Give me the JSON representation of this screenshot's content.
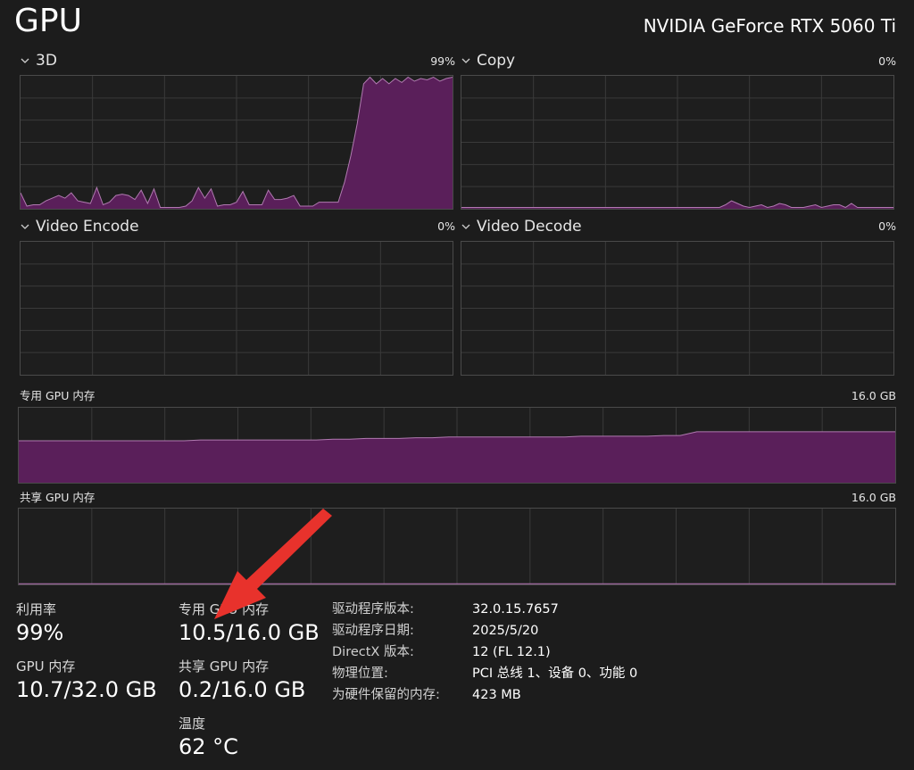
{
  "header": {
    "title": "GPU",
    "model": "NVIDIA GeForce RTX 5060 Ti"
  },
  "engines": [
    {
      "label": "3D",
      "pct": "99%",
      "values": [
        12,
        2,
        3,
        3,
        6,
        8,
        10,
        8,
        12,
        6,
        5,
        4,
        16,
        3,
        5,
        10,
        11,
        10,
        7,
        14,
        4,
        15,
        1,
        1,
        1,
        1,
        2,
        6,
        16,
        8,
        15,
        2,
        3,
        3,
        5,
        13,
        3,
        3,
        3,
        14,
        7,
        7,
        8,
        10,
        2,
        2,
        2,
        5,
        5,
        5,
        5,
        20,
        40,
        64,
        94,
        99,
        94,
        98,
        94,
        98,
        95,
        99,
        96,
        98,
        97,
        99,
        96,
        98,
        99
      ]
    },
    {
      "label": "Copy",
      "pct": "0%",
      "values": [
        1,
        1,
        1,
        1,
        1,
        1,
        1,
        1,
        1,
        1,
        1,
        1,
        1,
        1,
        1,
        1,
        1,
        1,
        1,
        1,
        1,
        1,
        1,
        1,
        1,
        1,
        1,
        1,
        1,
        1,
        1,
        1,
        1,
        1,
        1,
        1,
        1,
        1,
        1,
        1,
        1,
        1,
        1,
        1,
        3,
        6,
        4,
        2,
        1,
        2,
        3,
        1,
        2,
        4,
        3,
        1,
        1,
        1,
        2,
        3,
        1,
        2,
        3,
        3,
        1,
        4,
        1,
        1,
        1,
        1,
        1,
        1,
        1
      ]
    },
    {
      "label": "Video Encode",
      "pct": "0%",
      "values": []
    },
    {
      "label": "Video Decode",
      "pct": "0%",
      "values": []
    }
  ],
  "dedicated_memory": {
    "label": "专用 GPU 内存",
    "max": "16.0 GB",
    "values": [
      56,
      56,
      56,
      56,
      56,
      56,
      56,
      56,
      56,
      56,
      56,
      57,
      57,
      57,
      57,
      57,
      57,
      57,
      57,
      58,
      58,
      59,
      59,
      59,
      60,
      60,
      61,
      61,
      61,
      61,
      61,
      61,
      61,
      61,
      62,
      62,
      62,
      62,
      62,
      63,
      63,
      68,
      68,
      68,
      68,
      68,
      68,
      68,
      68,
      68,
      68,
      68,
      68,
      68
    ]
  },
  "shared_memory": {
    "label": "共享 GPU 内存",
    "max": "16.0 GB",
    "values": [
      1,
      1,
      1,
      1,
      1,
      1,
      1,
      1,
      1,
      1,
      1,
      1,
      1,
      1,
      1,
      1,
      1,
      1,
      1,
      1
    ]
  },
  "stats": {
    "utilization": {
      "label": "利用率",
      "value": "99%"
    },
    "gpu_memory": {
      "label": "GPU 内存",
      "value": "10.7/32.0 GB"
    },
    "dedicated": {
      "label": "专用 GPU 内存",
      "value": "10.5/16.0 GB"
    },
    "shared": {
      "label": "共享 GPU 内存",
      "value": "0.2/16.0 GB"
    },
    "temperature": {
      "label": "温度",
      "value": "62 °C"
    }
  },
  "info": [
    {
      "label": "驱动程序版本:",
      "value": "32.0.15.7657"
    },
    {
      "label": "驱动程序日期:",
      "value": "2025/5/20"
    },
    {
      "label": "DirectX 版本:",
      "value": "12 (FL 12.1)"
    },
    {
      "label": "物理位置:",
      "value": "PCI 总线 1、设备 0、功能 0"
    },
    {
      "label": "为硬件保留的内存:",
      "value": "423 MB"
    }
  ],
  "colors": {
    "accent_fill": "#5a1f5a",
    "accent_line": "#b07ab0",
    "grid": "#3a3a3a",
    "arrow": "#e8322c"
  }
}
